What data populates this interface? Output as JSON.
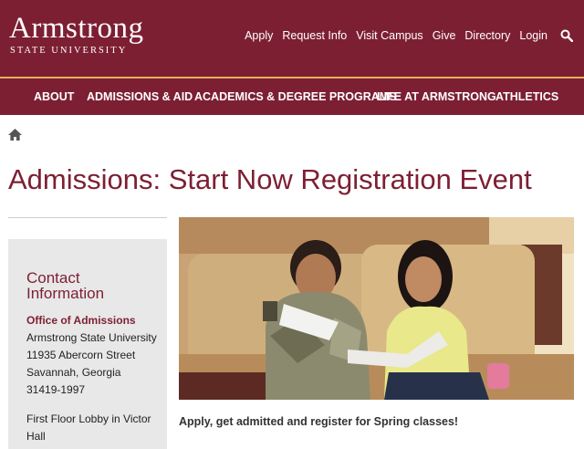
{
  "brand": {
    "name": "Armstrong",
    "subtitle": "STATE UNIVERSITY",
    "colors": {
      "primary": "#7d1f33",
      "accent_line": "#e1b45c",
      "sidebar_bg": "#e8e8e8"
    }
  },
  "utility_nav": [
    "Apply",
    "Request Info",
    "Visit Campus",
    "Give",
    "Directory",
    "Login"
  ],
  "icons": {
    "search": "search-icon",
    "home": "home-icon"
  },
  "main_nav": [
    "ABOUT",
    "ADMISSIONS & AID",
    "ACADEMICS & DEGREE PROGRAMS",
    "LIFE AT ARMSTRONG",
    "ATHLETICS"
  ],
  "page": {
    "title": "Admissions: Start Now Registration Event",
    "caption": "Apply, get admitted and register for Spring classes!"
  },
  "contact": {
    "heading": "Contact Information",
    "office": "Office of Admissions",
    "lines": [
      "Armstrong State University",
      "11935 Abercorn Street",
      "Savannah, Georgia",
      "31419-1997"
    ],
    "location_line1": "First Floor Lobby in Victor",
    "location_line2": "Hall"
  }
}
